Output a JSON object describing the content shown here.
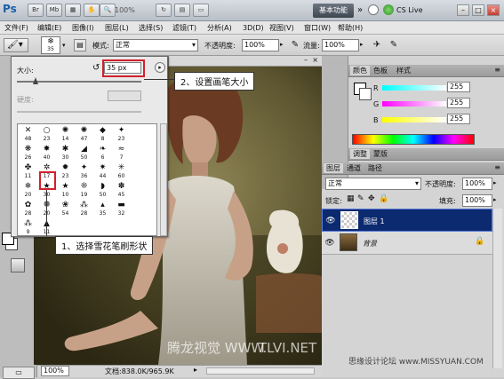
{
  "titlebar": {
    "app_logo": "Ps",
    "btn_br": "Br",
    "btn_mb": "Mb",
    "zoom": "100%",
    "workspace_button": "基本功能",
    "cslive": "CS Live",
    "win_min": "–",
    "win_max": "□",
    "win_close": "×"
  },
  "menu": [
    "文件(F)",
    "编辑(E)",
    "图像(I)",
    "图层(L)",
    "选择(S)",
    "滤镜(T)",
    "分析(A)",
    "3D(D)",
    "视图(V)",
    "窗口(W)",
    "帮助(H)"
  ],
  "options": {
    "brush_size_chip": "35",
    "mode_label": "模式:",
    "mode_value": "正常",
    "opacity_label": "不透明度:",
    "opacity_value": "100%",
    "flow_label": "流量:",
    "flow_value": "100%"
  },
  "brush_picker": {
    "size_label": "大小:",
    "size_value": "35 px",
    "size_level": 0.15,
    "hardness_label": "硬度:",
    "presets": [
      {
        "glyph": "✕",
        "size": "48"
      },
      {
        "glyph": "○",
        "size": "23"
      },
      {
        "glyph": "✺",
        "size": "14"
      },
      {
        "glyph": "✺",
        "size": "47"
      },
      {
        "glyph": "◆",
        "size": "8"
      },
      {
        "glyph": "✦",
        "size": "23"
      },
      {
        "glyph": "",
        "size": ""
      },
      {
        "glyph": "❋",
        "size": "26"
      },
      {
        "glyph": "✸",
        "size": "40"
      },
      {
        "glyph": "✱",
        "size": "30"
      },
      {
        "glyph": "◢",
        "size": "50"
      },
      {
        "glyph": "❧",
        "size": "6"
      },
      {
        "glyph": "≈",
        "size": "7"
      },
      {
        "glyph": "",
        "size": ""
      },
      {
        "glyph": "✤",
        "size": "11"
      },
      {
        "glyph": "✲",
        "size": "17"
      },
      {
        "glyph": "✹",
        "size": "23"
      },
      {
        "glyph": "✦",
        "size": "36"
      },
      {
        "glyph": "✷",
        "size": "44"
      },
      {
        "glyph": "✳",
        "size": "60"
      },
      {
        "glyph": "",
        "size": ""
      },
      {
        "glyph": "❄",
        "size": "20"
      },
      {
        "glyph": "★",
        "size": "30"
      },
      {
        "glyph": "★",
        "size": "10"
      },
      {
        "glyph": "❊",
        "size": "19"
      },
      {
        "glyph": "◗",
        "size": "50"
      },
      {
        "glyph": "✽",
        "size": "45"
      },
      {
        "glyph": "",
        "size": ""
      },
      {
        "glyph": "✿",
        "size": "28"
      },
      {
        "glyph": "❁",
        "size": "20"
      },
      {
        "glyph": "❀",
        "size": "54"
      },
      {
        "glyph": "⁂",
        "size": "28"
      },
      {
        "glyph": "▴",
        "size": "35"
      },
      {
        "glyph": "▬",
        "size": "32"
      },
      {
        "glyph": "",
        "size": ""
      },
      {
        "glyph": "⁂",
        "size": "9"
      },
      {
        "glyph": "▲",
        "size": "11"
      },
      {
        "glyph": "",
        "size": ""
      },
      {
        "glyph": "",
        "size": ""
      },
      {
        "glyph": "",
        "size": ""
      },
      {
        "glyph": "",
        "size": ""
      },
      {
        "glyph": "",
        "size": ""
      }
    ]
  },
  "callouts": {
    "step1": "1、选择雪花笔刷形状",
    "step2": "2、设置画笔大小"
  },
  "color_panel": {
    "tabs": [
      "颜色",
      "色板",
      "样式"
    ],
    "r_label": "R",
    "r_value": "255",
    "g_label": "G",
    "g_value": "255",
    "b_label": "B",
    "b_value": "255"
  },
  "adjust_panel": {
    "tabs": [
      "调整",
      "蒙版"
    ]
  },
  "layers_panel": {
    "tabs": [
      "图层",
      "通道",
      "路径"
    ],
    "blend_mode": "正常",
    "opacity_label": "不透明度:",
    "opacity_value": "100%",
    "lock_label": "锁定:",
    "fill_label": "填充:",
    "fill_value": "100%",
    "layers": [
      {
        "name": "图层 1"
      },
      {
        "name": "背景"
      }
    ]
  },
  "status": {
    "zoom": "100%",
    "doc_info": "文档:838.0K/965.9K"
  },
  "watermarks": {
    "tlvi": "TLVI.NET",
    "tlvi_cn": "腾龙视觉 WWW.",
    "missyuan": "思缘设计论坛 www.MISSYUAN.COM"
  },
  "colors": {
    "accent": "#d2202a",
    "layer_selected": "#0b2a6f"
  }
}
